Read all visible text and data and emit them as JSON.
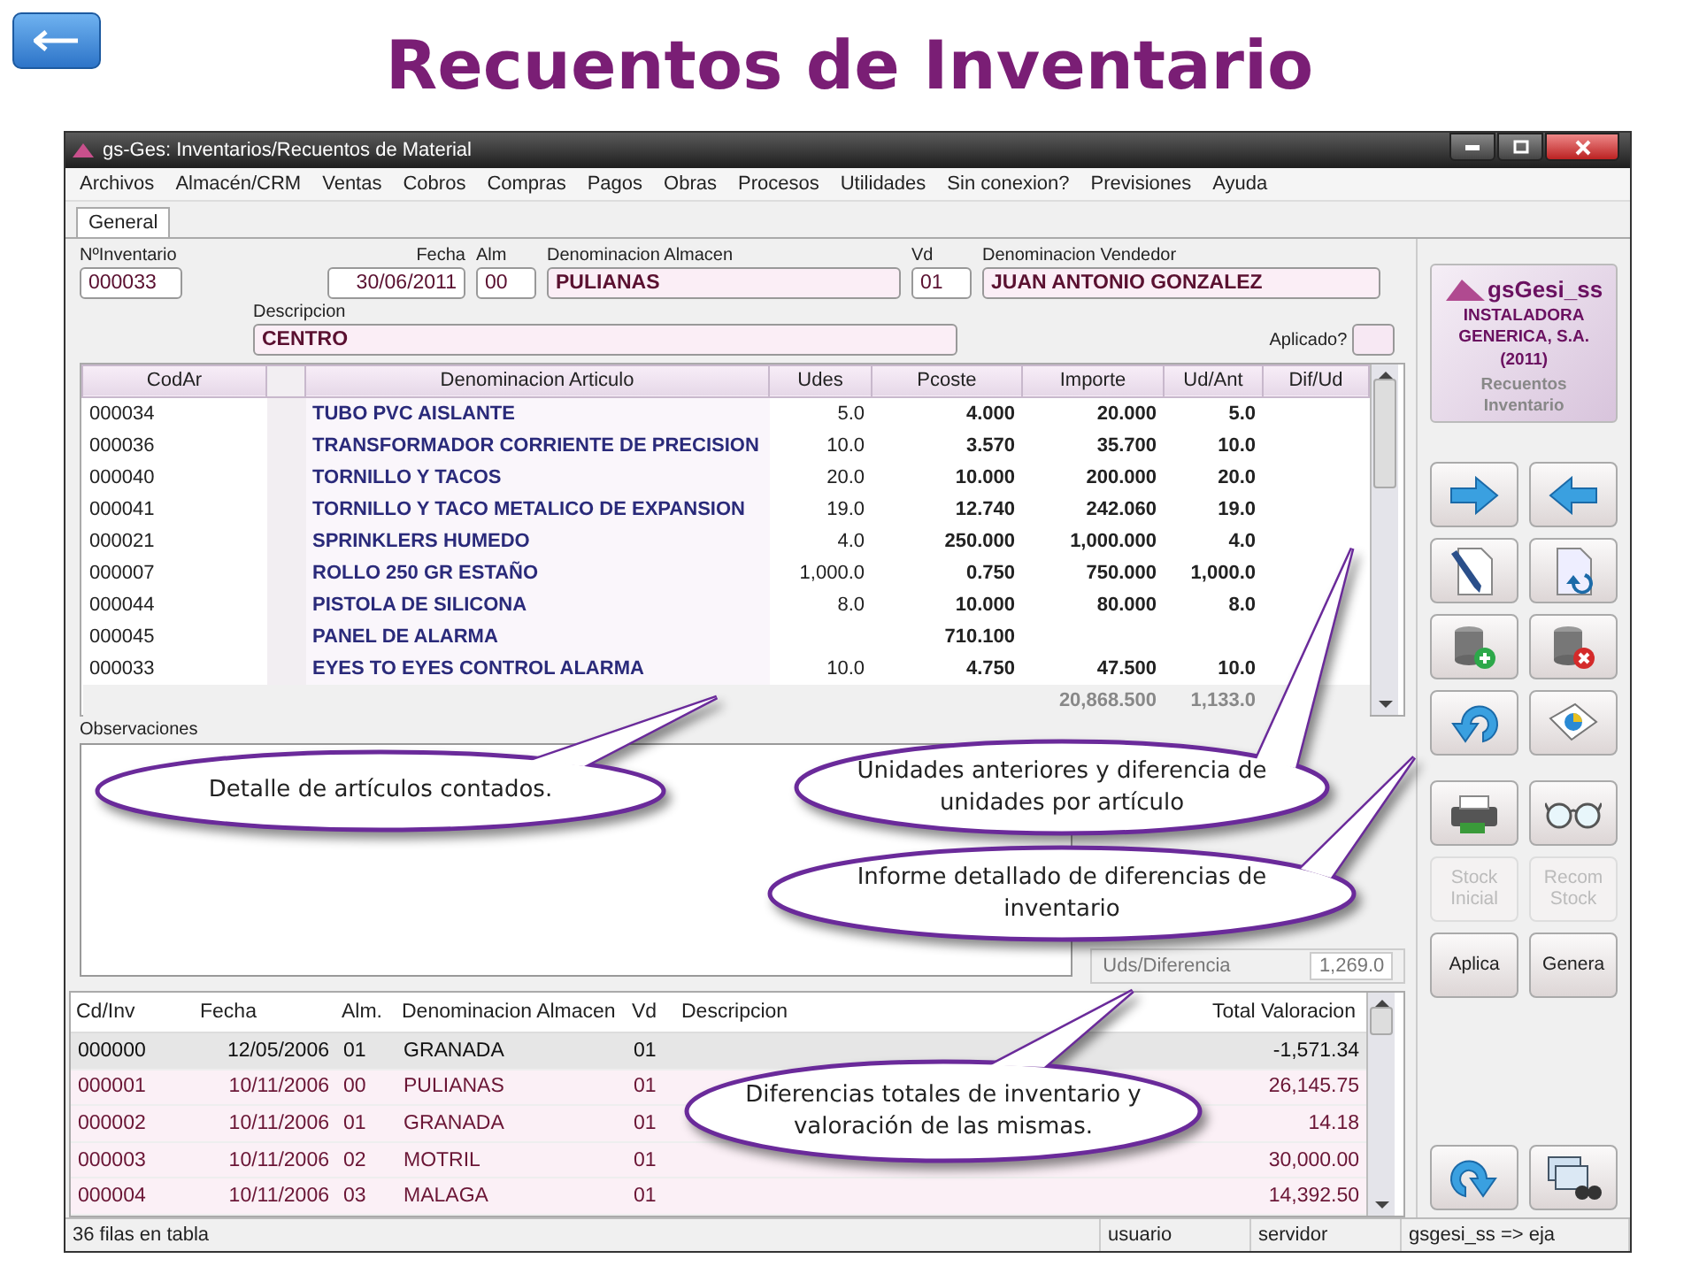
{
  "slide": {
    "title": "Recuentos de Inventario"
  },
  "window": {
    "title": "gs-Ges: Inventarios/Recuentos de Material",
    "menu": [
      "Archivos",
      "Almacén/CRM",
      "Ventas",
      "Cobros",
      "Compras",
      "Pagos",
      "Obras",
      "Procesos",
      "Utilidades",
      "Sin conexion?",
      "Previsiones",
      "Ayuda"
    ],
    "tabs": [
      {
        "label": "General",
        "selected": true
      }
    ]
  },
  "form": {
    "fields": [
      {
        "label": "NºInventario",
        "value": "000033"
      },
      {
        "label": "Fecha",
        "value": "30/06/2011"
      },
      {
        "label": "Alm",
        "value": "00"
      },
      {
        "label": "Denominacion Almacen",
        "value": "PULIANAS"
      },
      {
        "label": "Vd",
        "value": "01"
      },
      {
        "label": "Denominacion Vendedor",
        "value": "JUAN ANTONIO GONZALEZ"
      },
      {
        "label": "Descripcion",
        "value": "CENTRO"
      }
    ],
    "aplicado": {
      "label": "Aplicado?",
      "checked": false
    }
  },
  "items": {
    "columns": [
      "CodAr",
      "Denominacion Articulo",
      "Udes",
      "Pcoste",
      "Importe",
      "Ud/Ant",
      "Dif/Ud"
    ],
    "rows": [
      {
        "cod": "000034",
        "name": "TUBO PVC AISLANTE",
        "udes": "5.0",
        "pcoste": "4.000",
        "importe": "20.000",
        "ud_ant": "5.0"
      },
      {
        "cod": "000036",
        "name": "TRANSFORMADOR CORRIENTE DE PRECISION",
        "udes": "10.0",
        "pcoste": "3.570",
        "importe": "35.700",
        "ud_ant": "10.0"
      },
      {
        "cod": "000040",
        "name": "TORNILLO Y TACOS",
        "udes": "20.0",
        "pcoste": "10.000",
        "importe": "200.000",
        "ud_ant": "20.0"
      },
      {
        "cod": "000041",
        "name": "TORNILLO Y TACO METALICO DE EXPANSION",
        "udes": "19.0",
        "pcoste": "12.740",
        "importe": "242.060",
        "ud_ant": "19.0"
      },
      {
        "cod": "000021",
        "name": "SPRINKLERS HUMEDO",
        "udes": "4.0",
        "pcoste": "250.000",
        "importe": "1,000.000",
        "ud_ant": "4.0"
      },
      {
        "cod": "000007",
        "name": "ROLLO 250 GR ESTAÑO",
        "udes": "1,000.0",
        "pcoste": "0.750",
        "importe": "750.000",
        "ud_ant": "1,000.0"
      },
      {
        "cod": "000044",
        "name": "PISTOLA DE SILICONA",
        "udes": "8.0",
        "pcoste": "10.000",
        "importe": "80.000",
        "ud_ant": "8.0"
      },
      {
        "cod": "000045",
        "name": "PANEL DE ALARMA",
        "pcoste": "710.100"
      },
      {
        "cod": "000033",
        "name": "EYES TO EYES CONTROL ALARMA",
        "udes": "10.0",
        "pcoste": "4.750",
        "importe": "47.500",
        "ud_ant": "10.0"
      }
    ],
    "totals": {
      "importe": "20,868.500",
      "ud_ant": "1,133.0"
    }
  },
  "observaciones": {
    "label": "Observaciones"
  },
  "summary": {
    "label": "Uds/Diferencia",
    "value": "1,269.0"
  },
  "inventories": {
    "columns": [
      "Cd/Inv",
      "Fecha",
      "Alm.",
      "Denominacion Almacen",
      "Vd",
      "Descripcion",
      "Total Valoracion"
    ],
    "rows": [
      {
        "cd": "000000",
        "fecha": "12/05/2006",
        "alm": "01",
        "almacen": "GRANADA",
        "vd": "01",
        "total": "-1,571.34",
        "selected": true
      },
      {
        "cd": "000001",
        "fecha": "10/11/2006",
        "alm": "00",
        "almacen": "PULIANAS",
        "vd": "01",
        "total": "26,145.75",
        "selected": false
      },
      {
        "cd": "000002",
        "fecha": "10/11/2006",
        "alm": "01",
        "almacen": "GRANADA",
        "vd": "01",
        "total": "14.18",
        "selected": false
      },
      {
        "cd": "000003",
        "fecha": "10/11/2006",
        "alm": "02",
        "almacen": "MOTRIL",
        "vd": "01",
        "total": "30,000.00",
        "selected": false
      },
      {
        "cd": "000004",
        "fecha": "10/11/2006",
        "alm": "03",
        "almacen": "MALAGA",
        "vd": "01",
        "total": "14,392.50",
        "selected": false
      }
    ]
  },
  "sidebar": {
    "logo": {
      "brand": "gsGesi_ss",
      "company": "INSTALADORA GENERICA, S.A. (2011)",
      "module": "Recuentos Inventario"
    },
    "tool_buttons": [
      {
        "kind": "forward"
      },
      {
        "kind": "back"
      },
      {
        "kind": "edit"
      },
      {
        "kind": "doc-undo"
      },
      {
        "kind": "db-add"
      },
      {
        "kind": "db-delete"
      },
      {
        "kind": "undo"
      },
      {
        "kind": "report"
      },
      {
        "kind": "print"
      },
      {
        "kind": "glasses"
      }
    ],
    "text_buttons": [
      {
        "label": "Stock Inicial",
        "disabled": true
      },
      {
        "label": "Recom Stock",
        "disabled": true
      },
      {
        "label": "Aplica",
        "disabled": false
      },
      {
        "label": "Genera",
        "disabled": false
      }
    ],
    "bottom_buttons": [
      {
        "kind": "return"
      },
      {
        "kind": "windows"
      }
    ]
  },
  "status_bar": [
    "36 filas en tabla",
    "usuario",
    "servidor",
    "gsgesi_ss => eja"
  ],
  "callouts": [
    {
      "text": "Detalle de artículos contados."
    },
    {
      "text": "Unidades anteriores y diferencia de unidades por artículo"
    },
    {
      "text": "Informe detallado de diferencias de inventario"
    },
    {
      "text": "Diferencias totales de inventario y valoración de las mismas."
    }
  ]
}
